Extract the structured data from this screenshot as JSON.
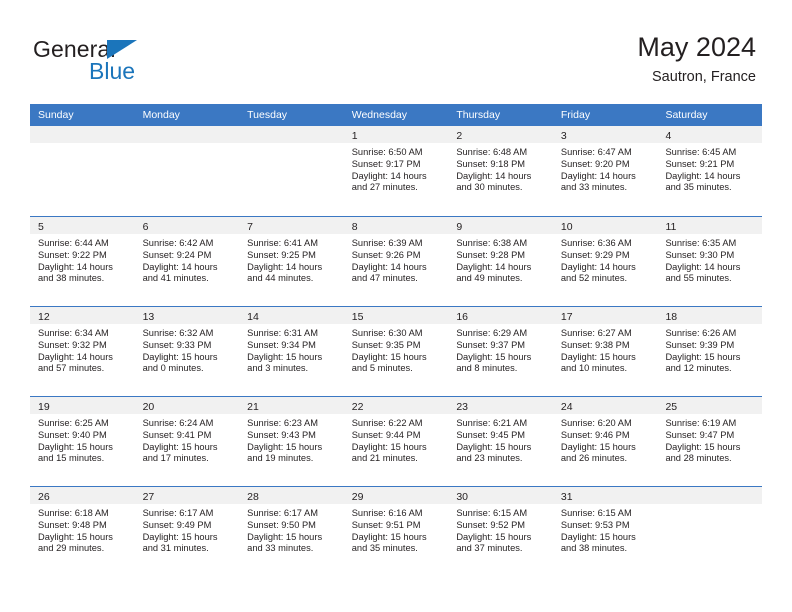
{
  "brand": {
    "name_primary": "General",
    "name_secondary": "Blue",
    "flag_icon": "triangle-flag-icon",
    "accent_color": "#1b75bb"
  },
  "header": {
    "title": "May 2024",
    "subtitle": "Sautron, France"
  },
  "theme": {
    "header_blue": "#3b78c3",
    "day_band_gray": "#f1f1f1",
    "text_color": "#231f20"
  },
  "weekdays": [
    "Sunday",
    "Monday",
    "Tuesday",
    "Wednesday",
    "Thursday",
    "Friday",
    "Saturday"
  ],
  "weeks": [
    [
      {
        "day": "",
        "lines": []
      },
      {
        "day": "",
        "lines": []
      },
      {
        "day": "",
        "lines": []
      },
      {
        "day": "1",
        "lines": [
          "Sunrise: 6:50 AM",
          "Sunset: 9:17 PM",
          "Daylight: 14 hours",
          "and 27 minutes."
        ]
      },
      {
        "day": "2",
        "lines": [
          "Sunrise: 6:48 AM",
          "Sunset: 9:18 PM",
          "Daylight: 14 hours",
          "and 30 minutes."
        ]
      },
      {
        "day": "3",
        "lines": [
          "Sunrise: 6:47 AM",
          "Sunset: 9:20 PM",
          "Daylight: 14 hours",
          "and 33 minutes."
        ]
      },
      {
        "day": "4",
        "lines": [
          "Sunrise: 6:45 AM",
          "Sunset: 9:21 PM",
          "Daylight: 14 hours",
          "and 35 minutes."
        ]
      }
    ],
    [
      {
        "day": "5",
        "lines": [
          "Sunrise: 6:44 AM",
          "Sunset: 9:22 PM",
          "Daylight: 14 hours",
          "and 38 minutes."
        ]
      },
      {
        "day": "6",
        "lines": [
          "Sunrise: 6:42 AM",
          "Sunset: 9:24 PM",
          "Daylight: 14 hours",
          "and 41 minutes."
        ]
      },
      {
        "day": "7",
        "lines": [
          "Sunrise: 6:41 AM",
          "Sunset: 9:25 PM",
          "Daylight: 14 hours",
          "and 44 minutes."
        ]
      },
      {
        "day": "8",
        "lines": [
          "Sunrise: 6:39 AM",
          "Sunset: 9:26 PM",
          "Daylight: 14 hours",
          "and 47 minutes."
        ]
      },
      {
        "day": "9",
        "lines": [
          "Sunrise: 6:38 AM",
          "Sunset: 9:28 PM",
          "Daylight: 14 hours",
          "and 49 minutes."
        ]
      },
      {
        "day": "10",
        "lines": [
          "Sunrise: 6:36 AM",
          "Sunset: 9:29 PM",
          "Daylight: 14 hours",
          "and 52 minutes."
        ]
      },
      {
        "day": "11",
        "lines": [
          "Sunrise: 6:35 AM",
          "Sunset: 9:30 PM",
          "Daylight: 14 hours",
          "and 55 minutes."
        ]
      }
    ],
    [
      {
        "day": "12",
        "lines": [
          "Sunrise: 6:34 AM",
          "Sunset: 9:32 PM",
          "Daylight: 14 hours",
          "and 57 minutes."
        ]
      },
      {
        "day": "13",
        "lines": [
          "Sunrise: 6:32 AM",
          "Sunset: 9:33 PM",
          "Daylight: 15 hours",
          "and 0 minutes."
        ]
      },
      {
        "day": "14",
        "lines": [
          "Sunrise: 6:31 AM",
          "Sunset: 9:34 PM",
          "Daylight: 15 hours",
          "and 3 minutes."
        ]
      },
      {
        "day": "15",
        "lines": [
          "Sunrise: 6:30 AM",
          "Sunset: 9:35 PM",
          "Daylight: 15 hours",
          "and 5 minutes."
        ]
      },
      {
        "day": "16",
        "lines": [
          "Sunrise: 6:29 AM",
          "Sunset: 9:37 PM",
          "Daylight: 15 hours",
          "and 8 minutes."
        ]
      },
      {
        "day": "17",
        "lines": [
          "Sunrise: 6:27 AM",
          "Sunset: 9:38 PM",
          "Daylight: 15 hours",
          "and 10 minutes."
        ]
      },
      {
        "day": "18",
        "lines": [
          "Sunrise: 6:26 AM",
          "Sunset: 9:39 PM",
          "Daylight: 15 hours",
          "and 12 minutes."
        ]
      }
    ],
    [
      {
        "day": "19",
        "lines": [
          "Sunrise: 6:25 AM",
          "Sunset: 9:40 PM",
          "Daylight: 15 hours",
          "and 15 minutes."
        ]
      },
      {
        "day": "20",
        "lines": [
          "Sunrise: 6:24 AM",
          "Sunset: 9:41 PM",
          "Daylight: 15 hours",
          "and 17 minutes."
        ]
      },
      {
        "day": "21",
        "lines": [
          "Sunrise: 6:23 AM",
          "Sunset: 9:43 PM",
          "Daylight: 15 hours",
          "and 19 minutes."
        ]
      },
      {
        "day": "22",
        "lines": [
          "Sunrise: 6:22 AM",
          "Sunset: 9:44 PM",
          "Daylight: 15 hours",
          "and 21 minutes."
        ]
      },
      {
        "day": "23",
        "lines": [
          "Sunrise: 6:21 AM",
          "Sunset: 9:45 PM",
          "Daylight: 15 hours",
          "and 23 minutes."
        ]
      },
      {
        "day": "24",
        "lines": [
          "Sunrise: 6:20 AM",
          "Sunset: 9:46 PM",
          "Daylight: 15 hours",
          "and 26 minutes."
        ]
      },
      {
        "day": "25",
        "lines": [
          "Sunrise: 6:19 AM",
          "Sunset: 9:47 PM",
          "Daylight: 15 hours",
          "and 28 minutes."
        ]
      }
    ],
    [
      {
        "day": "26",
        "lines": [
          "Sunrise: 6:18 AM",
          "Sunset: 9:48 PM",
          "Daylight: 15 hours",
          "and 29 minutes."
        ]
      },
      {
        "day": "27",
        "lines": [
          "Sunrise: 6:17 AM",
          "Sunset: 9:49 PM",
          "Daylight: 15 hours",
          "and 31 minutes."
        ]
      },
      {
        "day": "28",
        "lines": [
          "Sunrise: 6:17 AM",
          "Sunset: 9:50 PM",
          "Daylight: 15 hours",
          "and 33 minutes."
        ]
      },
      {
        "day": "29",
        "lines": [
          "Sunrise: 6:16 AM",
          "Sunset: 9:51 PM",
          "Daylight: 15 hours",
          "and 35 minutes."
        ]
      },
      {
        "day": "30",
        "lines": [
          "Sunrise: 6:15 AM",
          "Sunset: 9:52 PM",
          "Daylight: 15 hours",
          "and 37 minutes."
        ]
      },
      {
        "day": "31",
        "lines": [
          "Sunrise: 6:15 AM",
          "Sunset: 9:53 PM",
          "Daylight: 15 hours",
          "and 38 minutes."
        ]
      },
      {
        "day": "",
        "lines": []
      }
    ]
  ]
}
